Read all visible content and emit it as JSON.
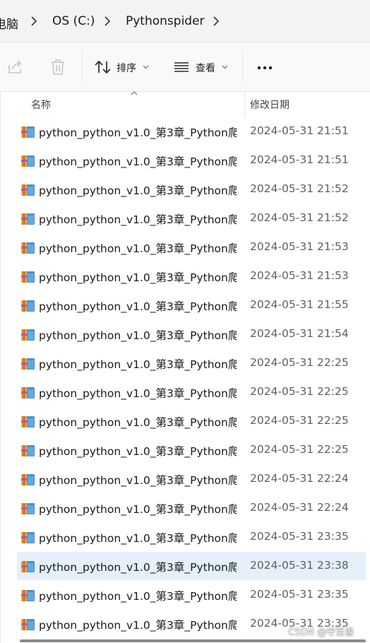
{
  "breadcrumb": {
    "items": [
      "电脑",
      "OS (C:)",
      "Pythonspider"
    ]
  },
  "toolbar": {
    "share_icon": "share-icon",
    "delete_icon": "trash-icon",
    "sort_label": "排序",
    "view_label": "查看",
    "more_label": "..."
  },
  "columns": {
    "name": "名称",
    "modified": "修改日期"
  },
  "files": [
    {
      "name": "python_python_v1.0_第3章_Python爬...",
      "date": "2024-05-31 21:51"
    },
    {
      "name": "python_python_v1.0_第3章_Python爬...",
      "date": "2024-05-31 21:51"
    },
    {
      "name": "python_python_v1.0_第3章_Python爬...",
      "date": "2024-05-31 21:52"
    },
    {
      "name": "python_python_v1.0_第3章_Python爬...",
      "date": "2024-05-31 21:52"
    },
    {
      "name": "python_python_v1.0_第3章_Python爬...",
      "date": "2024-05-31 21:53"
    },
    {
      "name": "python_python_v1.0_第3章_Python爬...",
      "date": "2024-05-31 21:53"
    },
    {
      "name": "python_python_v1.0_第3章_Python爬...",
      "date": "2024-05-31 21:55"
    },
    {
      "name": "python_python_v1.0_第3章_Python爬...",
      "date": "2024-05-31 21:54"
    },
    {
      "name": "python_python_v1.0_第3章_Python爬...",
      "date": "2024-05-31 22:25"
    },
    {
      "name": "python_python_v1.0_第3章_Python爬...",
      "date": "2024-05-31 22:25"
    },
    {
      "name": "python_python_v1.0_第3章_Python爬...",
      "date": "2024-05-31 22:25"
    },
    {
      "name": "python_python_v1.0_第3章_Python爬...",
      "date": "2024-05-31 22:25"
    },
    {
      "name": "python_python_v1.0_第3章_Python爬...",
      "date": "2024-05-31 22:24"
    },
    {
      "name": "python_python_v1.0_第3章_Python爬...",
      "date": "2024-05-31 22:24"
    },
    {
      "name": "python_python_v1.0_第3章_Python爬...",
      "date": "2024-05-31 23:35"
    },
    {
      "name": "python_python_v1.0_第3章_Python爬...",
      "date": "2024-05-31 23:38",
      "selected": true
    },
    {
      "name": "python_python_v1.0_第3章_Python爬...",
      "date": "2024-05-31 23:35"
    },
    {
      "name": "python_python_v1.0_第3章_Python爬...",
      "date": "2024-05-31 23:35"
    }
  ],
  "watermark": "CSDN @守至善",
  "colors": {
    "selected_row": "#e5f0fb",
    "folder_icon": "archive-icon"
  }
}
